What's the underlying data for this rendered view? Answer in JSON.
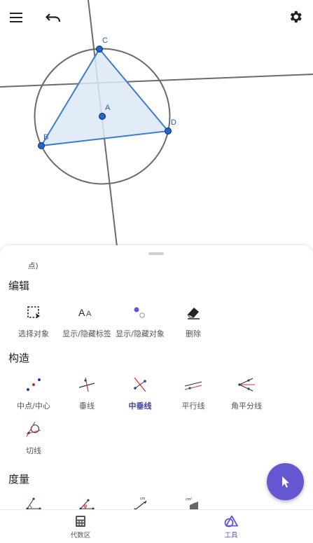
{
  "toolbar": {
    "menu_icon": "hamburger-menu-icon",
    "undo_icon": "undo-icon",
    "settings_icon": "gear-icon"
  },
  "construction": {
    "points": [
      {
        "label": "A"
      },
      {
        "label": "B"
      },
      {
        "label": "C"
      },
      {
        "label": "D"
      }
    ],
    "colors": {
      "polygon_stroke": "#3d7bd1",
      "polygon_fill": "#dde8f7",
      "point_fill": "#2266cc",
      "circle_stroke": "#6b6b6b",
      "line_stroke": "#6b6b6b",
      "label_color": "#1e60b7"
    }
  },
  "panel": {
    "previous_label": "点)",
    "sections": {
      "edit": {
        "title": "编辑",
        "tools": [
          {
            "label": "选择对象",
            "icon": "select-box-icon"
          },
          {
            "label": "显示/隐藏标签",
            "icon": "show-hide-label-icon"
          },
          {
            "label": "显示/隐藏对象",
            "icon": "show-hide-object-icon"
          },
          {
            "label": "删除",
            "icon": "eraser-icon"
          }
        ]
      },
      "construct": {
        "title": "构造",
        "tools": [
          {
            "label": "中点/中心",
            "icon": "midpoint-icon"
          },
          {
            "label": "垂线",
            "icon": "perpendicular-line-icon"
          },
          {
            "label": "中垂线",
            "icon": "perpendicular-bisector-icon",
            "selected": true
          },
          {
            "label": "平行线",
            "icon": "parallel-line-icon"
          },
          {
            "label": "角平分线",
            "icon": "angle-bisector-icon"
          },
          {
            "label": "切线",
            "icon": "tangent-icon"
          }
        ]
      },
      "measure": {
        "title": "度量",
        "tools": [
          {
            "icon": "angle-icon"
          },
          {
            "icon": "angle-given-size-icon"
          },
          {
            "icon": "distance-length-icon"
          },
          {
            "icon": "area-icon"
          }
        ]
      }
    },
    "measure_icon_units": {
      "length": "cm",
      "area": "cm²"
    }
  },
  "fab": {
    "icon": "cursor-pointer-icon",
    "color": "#6557d2"
  },
  "bottom_nav": {
    "tabs": [
      {
        "label": "代数区",
        "icon": "calculator-icon"
      },
      {
        "label": "工具",
        "icon": "tools-shapes-icon",
        "active": true
      }
    ]
  }
}
